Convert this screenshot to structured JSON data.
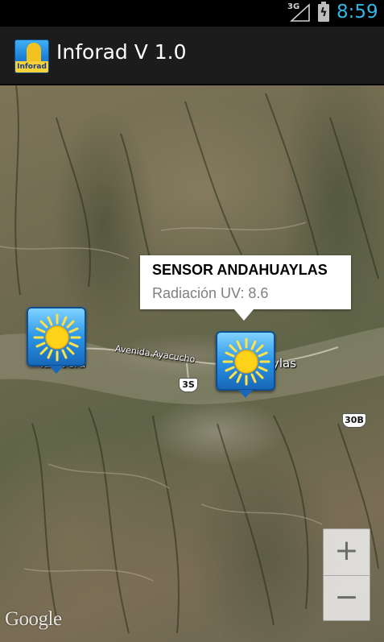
{
  "status_bar": {
    "network": "3G",
    "time": "8:59",
    "time_color": "#33b5e5"
  },
  "action_bar": {
    "title": "Inforad V 1.0",
    "icon": "inforad-app-icon",
    "icon_text": "Inforad"
  },
  "map": {
    "labels": {
      "talavera": "Talavera",
      "andahuaylas_partial": "ylas",
      "avenida": "Avenida Ayacucho"
    },
    "road_shields": {
      "route_3s": "3S",
      "route_30b": "30B"
    },
    "markers": [
      {
        "name": "sensor-talavera",
        "icon": "sun-icon"
      },
      {
        "name": "sensor-andahuaylas",
        "icon": "sun-icon"
      }
    ],
    "info_window": {
      "title": "SENSOR ANDAHUAYLAS",
      "snippet": "Radiación UV: 8.6"
    },
    "zoom": {
      "zoom_in": "+",
      "zoom_out": "−"
    },
    "attribution": "Google"
  }
}
